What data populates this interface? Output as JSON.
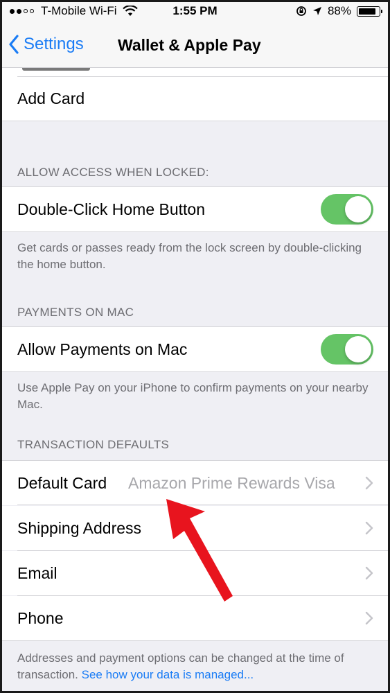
{
  "status_bar": {
    "carrier": "T-Mobile Wi-Fi",
    "time": "1:55 PM",
    "battery_percent": "88%",
    "battery_level": 0.88
  },
  "nav": {
    "back_label": "Settings",
    "title": "Wallet & Apple Pay"
  },
  "add_card": {
    "label": "Add Card"
  },
  "locked_section": {
    "header": "ALLOW ACCESS WHEN LOCKED:",
    "row_label": "Double-Click Home Button",
    "toggle_on": true,
    "footer": "Get cards or passes ready from the lock screen by double-clicking the home button."
  },
  "mac_section": {
    "header": "PAYMENTS ON MAC",
    "row_label": "Allow Payments on Mac",
    "toggle_on": true,
    "footer": "Use Apple Pay on your iPhone to confirm payments on your nearby Mac."
  },
  "transaction_section": {
    "header": "TRANSACTION DEFAULTS",
    "rows": [
      {
        "label": "Default Card",
        "value": "Amazon Prime Rewards Visa"
      },
      {
        "label": "Shipping Address",
        "value": ""
      },
      {
        "label": "Email",
        "value": ""
      },
      {
        "label": "Phone",
        "value": ""
      }
    ],
    "footer_text": "Addresses and payment options can be changed at the time of transaction. ",
    "footer_link": "See how your data is managed..."
  },
  "colors": {
    "accent": "#1a7cf5",
    "toggle_on": "#65c466",
    "annotation_arrow": "#e8141e"
  },
  "icons": [
    "wifi-icon",
    "lock-rotation-icon",
    "location-arrow-icon",
    "battery-icon",
    "back-chevron-icon",
    "chevron-right-icon",
    "red-arrow-annotation"
  ]
}
